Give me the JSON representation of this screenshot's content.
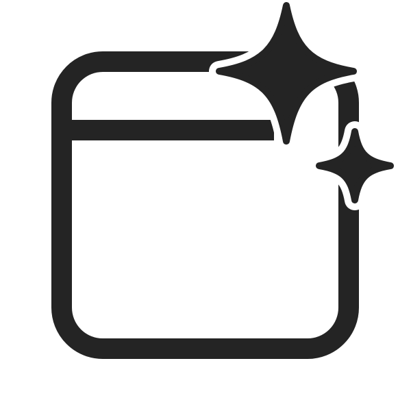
{
  "icon": {
    "name": "window-sparkle-icon",
    "color": "#242424",
    "background": "#ffffff"
  }
}
